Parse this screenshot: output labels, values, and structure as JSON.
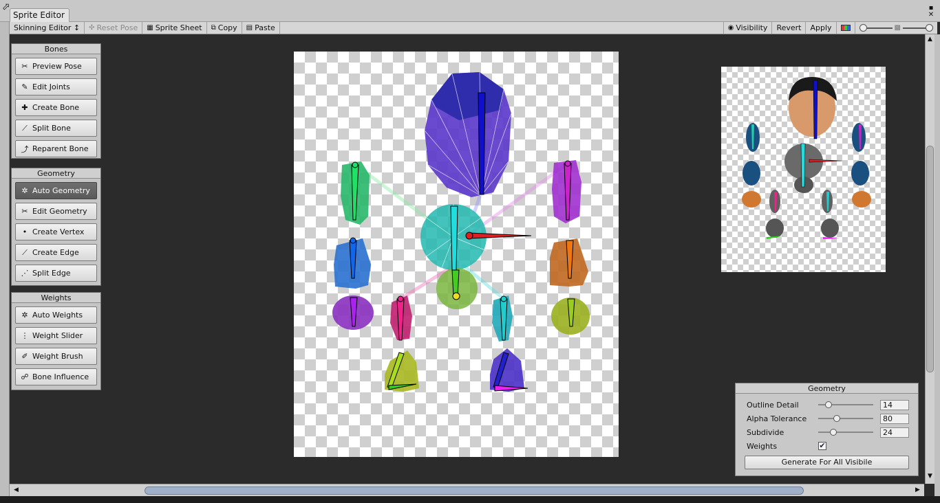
{
  "window": {
    "tab_title": "Sprite Editor",
    "back_glyph": "⬀",
    "minimize_glyph": "▪",
    "close_glyph": "✕"
  },
  "toolbar": {
    "mode_dropdown": "Skinning Editor ↕",
    "reset_pose": "Reset Pose",
    "sprite_sheet": "Sprite Sheet",
    "copy": "Copy",
    "paste": "Paste",
    "visibility": "Visibility",
    "revert": "Revert",
    "apply": "Apply",
    "zoom_level": 0.0
  },
  "panels": {
    "bones": {
      "title": "Bones",
      "buttons": [
        "Preview Pose",
        "Edit Joints",
        "Create Bone",
        "Split Bone",
        "Reparent Bone"
      ]
    },
    "geometry": {
      "title": "Geometry",
      "buttons": [
        "Auto Geometry",
        "Edit Geometry",
        "Create Vertex",
        "Create Edge",
        "Split Edge"
      ],
      "active": "Auto Geometry"
    },
    "weights": {
      "title": "Weights",
      "buttons": [
        "Auto Weights",
        "Weight Slider",
        "Weight Brush",
        "Bone Influence"
      ]
    }
  },
  "geometry_settings": {
    "title": "Geometry",
    "outline_detail_label": "Outline Detail",
    "outline_detail_value": "14",
    "alpha_tolerance_label": "Alpha Tolerance",
    "alpha_tolerance_value": "80",
    "subdivide_label": "Subdivide",
    "subdivide_value": "24",
    "weights_label": "Weights",
    "weights_checked": true,
    "generate_button": "Generate For All Visibile"
  },
  "colors": {
    "active_tool": "#636363",
    "background": "#2b2b2b",
    "scroll_thumb": "#9fb0c8"
  }
}
